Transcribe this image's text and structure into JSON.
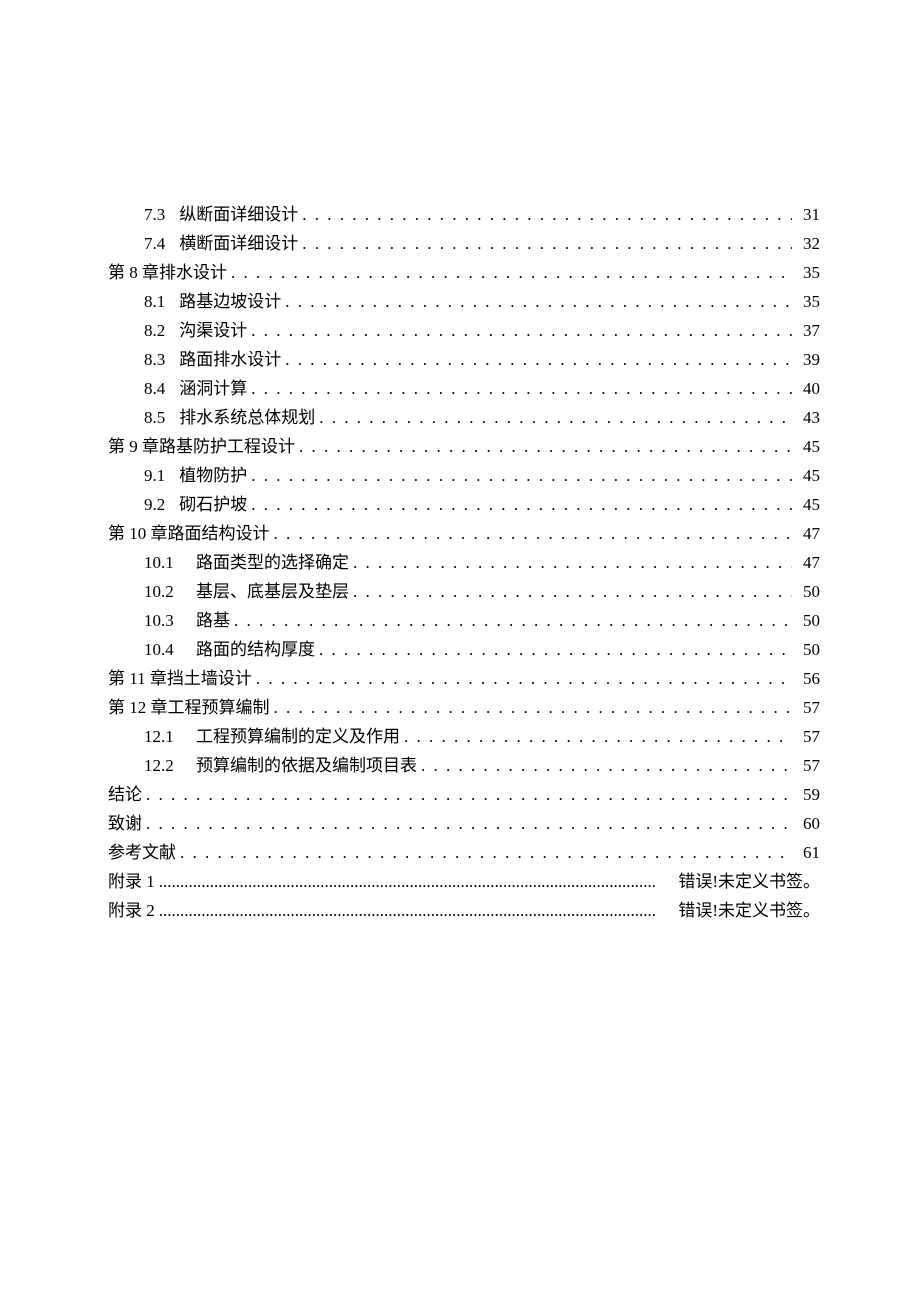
{
  "toc": [
    {
      "level": 2,
      "num": "7.3",
      "title": "纵断面详细设计",
      "page": "31",
      "leader": "dots"
    },
    {
      "level": 2,
      "num": "7.4",
      "title": "横断面详细设计",
      "page": "32",
      "leader": "dots"
    },
    {
      "level": 1,
      "num": "",
      "title": "第 8 章排水设计",
      "page": "35",
      "leader": "dots"
    },
    {
      "level": 2,
      "num": "8.1",
      "title": "路基边坡设计",
      "page": "35",
      "leader": "dots"
    },
    {
      "level": 2,
      "num": "8.2",
      "title": "沟渠设计",
      "page": "37",
      "leader": "dots"
    },
    {
      "level": 2,
      "num": "8.3",
      "title": "路面排水设计",
      "page": "39",
      "leader": "dots"
    },
    {
      "level": 2,
      "num": "8.4",
      "title": "涵洞计算",
      "page": "40",
      "leader": "dots"
    },
    {
      "level": 2,
      "num": "8.5",
      "title": "排水系统总体规划",
      "page": "43",
      "leader": "dots"
    },
    {
      "level": 1,
      "num": "",
      "title": "第 9 章路基防护工程设计",
      "page": "45",
      "leader": "dots"
    },
    {
      "level": 2,
      "num": "9.1",
      "title": "植物防护",
      "page": "45",
      "leader": "dots"
    },
    {
      "level": 2,
      "num": "9.2",
      "title": "砌石护坡",
      "page": "45",
      "leader": "dots"
    },
    {
      "level": 1,
      "num": "",
      "title": "第 10 章路面结构设计",
      "page": "47",
      "leader": "dots"
    },
    {
      "level": 2,
      "num": "10.1",
      "title": "路面类型的选择确定",
      "page": "47",
      "leader": "dots"
    },
    {
      "level": 2,
      "num": "10.2",
      "title": "基层、底基层及垫层",
      "page": "50",
      "leader": "dots"
    },
    {
      "level": 2,
      "num": "10.3",
      "title": "路基",
      "page": "50",
      "leader": "dots"
    },
    {
      "level": 2,
      "num": "10.4",
      "title": "路面的结构厚度",
      "page": "50",
      "leader": "dots"
    },
    {
      "level": 1,
      "num": "",
      "title": "第 11 章挡土墙设计",
      "page": "56",
      "leader": "dots"
    },
    {
      "level": 1,
      "num": "",
      "title": "第 12 章工程预算编制",
      "page": "57",
      "leader": "dots"
    },
    {
      "level": 2,
      "num": "12.1",
      "title": "工程预算编制的定义及作用",
      "page": "57",
      "leader": "dots"
    },
    {
      "level": 2,
      "num": "12.2",
      "title": "预算编制的依据及编制项目表",
      "page": "57",
      "leader": "dots"
    },
    {
      "level": 1,
      "num": "",
      "title": "结论",
      "page": "59",
      "leader": "dots"
    },
    {
      "level": 1,
      "num": "",
      "title": "致谢",
      "page": "60",
      "leader": "dots"
    },
    {
      "level": 1,
      "num": "",
      "title": "参考文献",
      "page": "61",
      "leader": "dots"
    },
    {
      "level": 1,
      "num": "",
      "title": "附录 1",
      "page": "错误!未定义书签。",
      "leader": "fine",
      "widepage": true
    },
    {
      "level": 1,
      "num": "",
      "title": "附录 2",
      "page": "错误!未定义书签。",
      "leader": "fine",
      "widepage": true
    }
  ]
}
